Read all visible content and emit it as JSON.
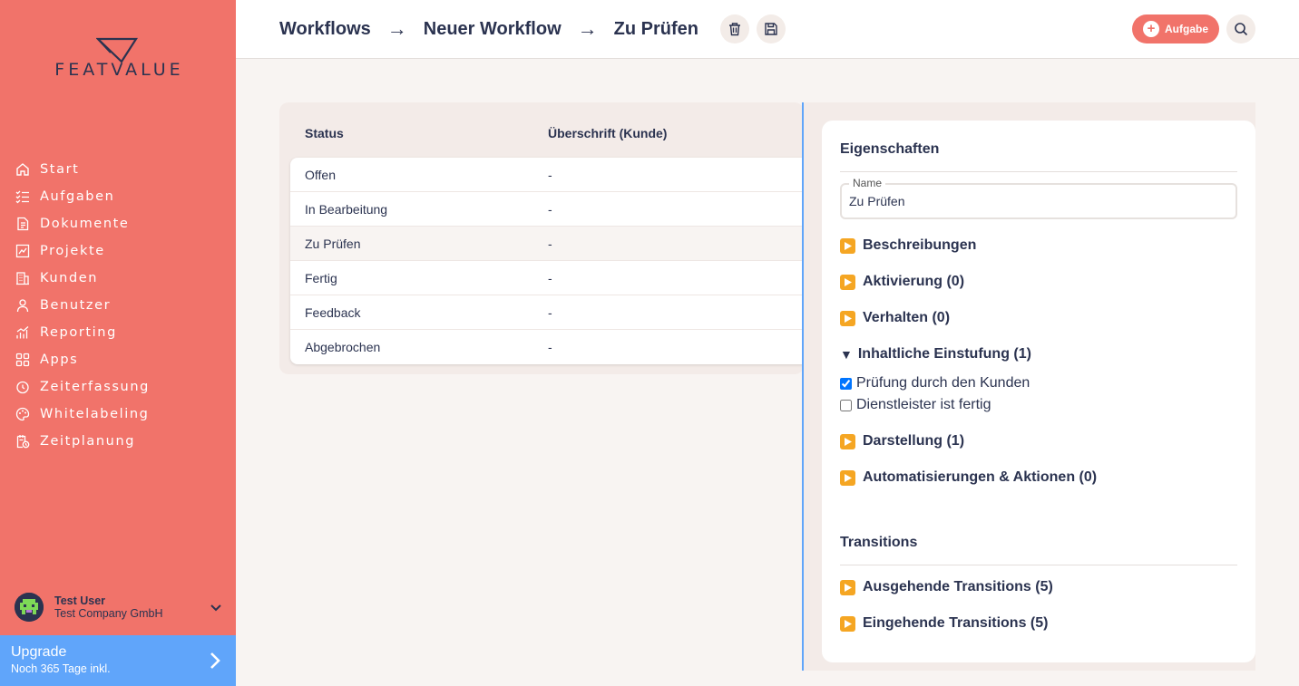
{
  "brand": {
    "name": "FEATVALUE"
  },
  "sidebar": {
    "items": [
      {
        "label": "Start",
        "icon": "home-icon"
      },
      {
        "label": "Aufgaben",
        "icon": "tasks-icon"
      },
      {
        "label": "Dokumente",
        "icon": "document-icon"
      },
      {
        "label": "Projekte",
        "icon": "projects-icon"
      },
      {
        "label": "Kunden",
        "icon": "building-icon"
      },
      {
        "label": "Benutzer",
        "icon": "user-icon"
      },
      {
        "label": "Reporting",
        "icon": "chart-icon"
      },
      {
        "label": "Apps",
        "icon": "apps-icon"
      },
      {
        "label": "Zeiterfassung",
        "icon": "timer-icon"
      },
      {
        "label": "Whitelabeling",
        "icon": "palette-icon"
      },
      {
        "label": "Zeitplanung",
        "icon": "schedule-icon"
      }
    ],
    "user": {
      "name": "Test User",
      "company": "Test Company GmbH"
    },
    "upgrade": {
      "title": "Upgrade",
      "subtitle": "Noch 365 Tage inkl."
    }
  },
  "header": {
    "breadcrumb": [
      "Workflows",
      "Neuer Workflow",
      "Zu Prüfen"
    ],
    "separator": "→",
    "task_button": "Aufgabe"
  },
  "table": {
    "columns": [
      "Status",
      "Überschrift (Kunde)"
    ],
    "rows": [
      [
        "Offen",
        "-"
      ],
      [
        "In Bearbeitung",
        "-"
      ],
      [
        "Zu Prüfen",
        "-"
      ],
      [
        "Fertig",
        "-"
      ],
      [
        "Feedback",
        "-"
      ],
      [
        "Abgebrochen",
        "-"
      ]
    ],
    "selected_row": 2
  },
  "panel": {
    "properties_title": "Eigenschaften",
    "name_label": "Name",
    "name_value": "Zu Prüfen",
    "sections": [
      "Beschreibungen",
      "Aktivierung (0)",
      "Verhalten (0)"
    ],
    "open_section": "Inhaltliche Einstufung (1)",
    "checkboxes": [
      {
        "label": "Prüfung durch den Kunden",
        "checked": true
      },
      {
        "label": "Dienstleister ist fertig",
        "checked": false
      }
    ],
    "sections_after": [
      "Darstellung (1)",
      "Automatisierungen & Aktionen (0)"
    ],
    "transitions_title": "Transitions",
    "transitions": [
      "Ausgehende Transitions (5)",
      "Eingehende Transitions (5)"
    ]
  },
  "colors": {
    "brand": "#f1736a",
    "accent": "#60a5fa",
    "text": "#2b3350",
    "orange": "#f5a623"
  }
}
